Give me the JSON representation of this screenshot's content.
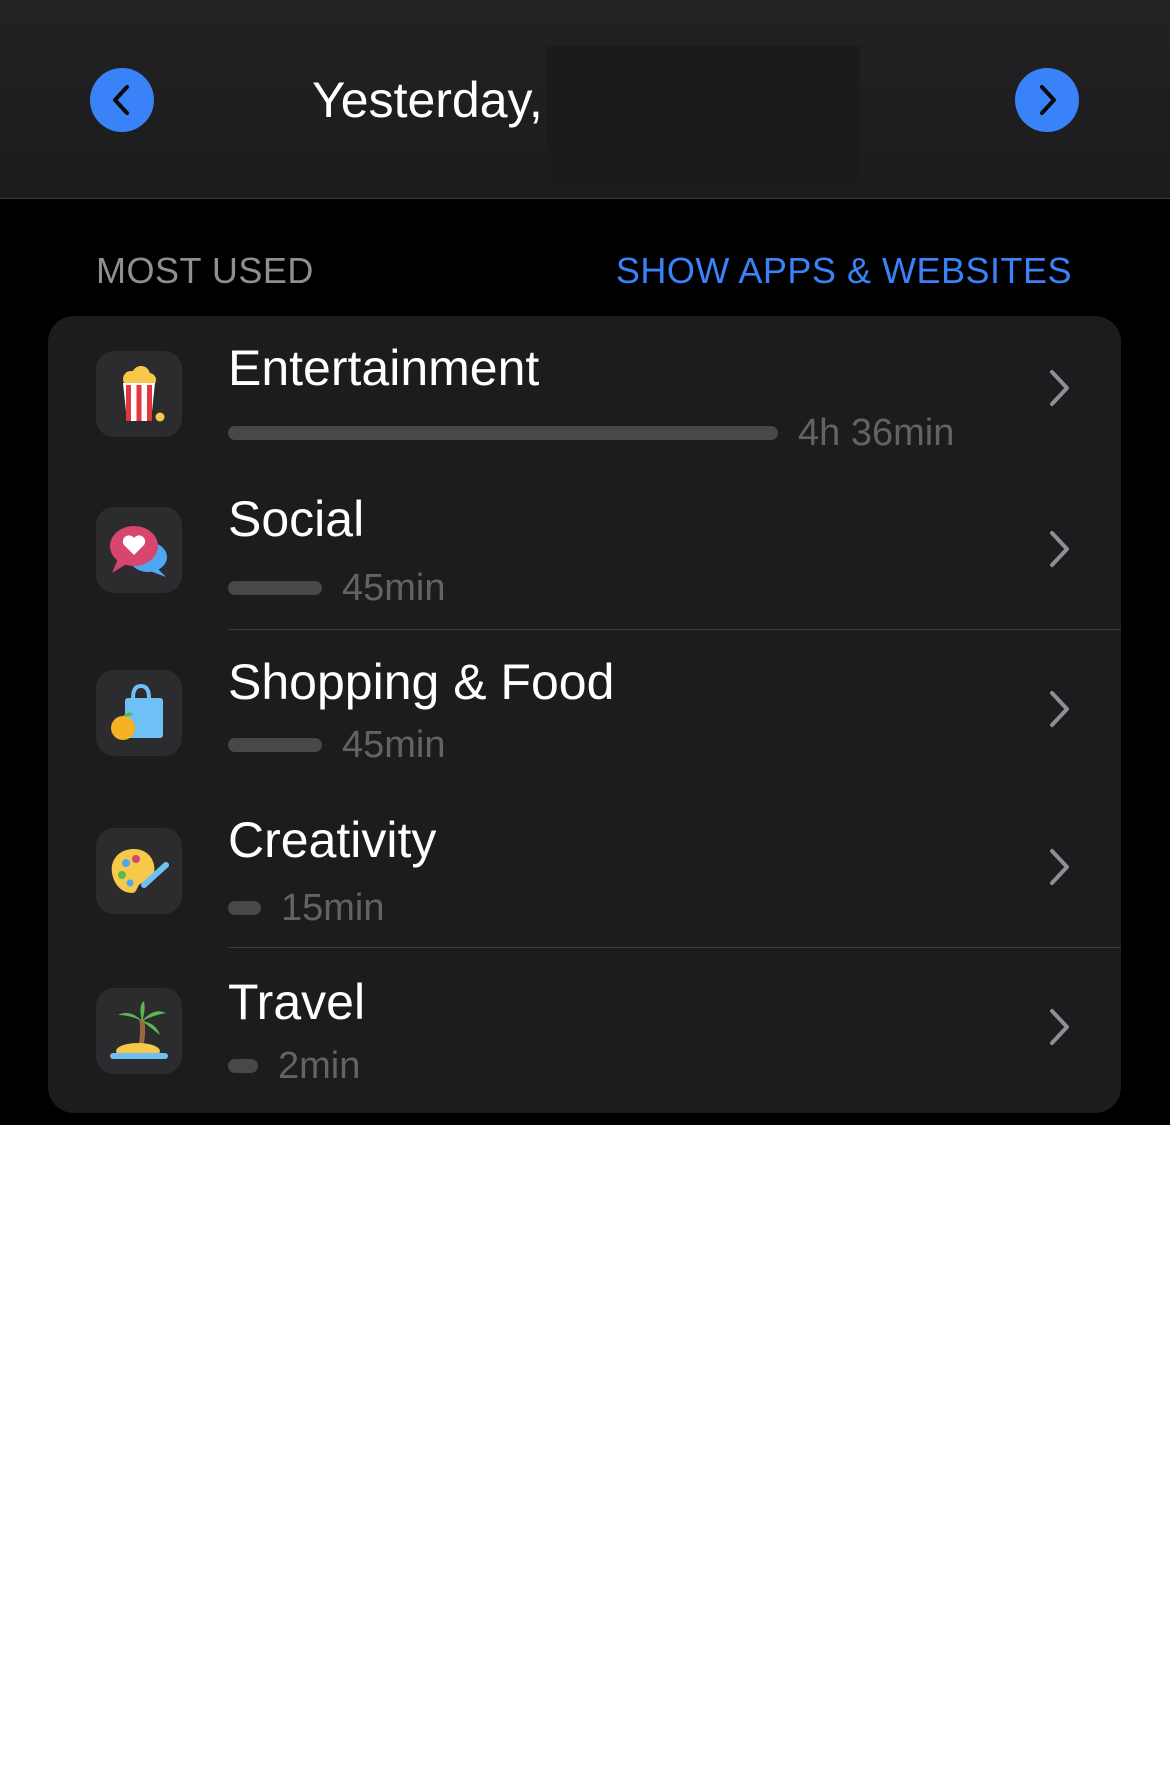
{
  "header": {
    "title": "Yesterday,",
    "prev_icon": "chevron-left-icon",
    "next_icon": "chevron-right-icon"
  },
  "section": {
    "label": "MOST USED",
    "action": "SHOW APPS & WEBSITES"
  },
  "colors": {
    "accent": "#3a82f7",
    "card_background": "#1c1c1e",
    "bar": "#48484a"
  },
  "categories": [
    {
      "name": "Entertainment",
      "time": "4h 36min",
      "usage_fraction": 1.0,
      "icon": "popcorn-icon"
    },
    {
      "name": "Social",
      "time": "45min",
      "usage_fraction": 0.17,
      "icon": "speech-bubbles-heart-icon"
    },
    {
      "name": "Shopping & Food",
      "time": "45min",
      "usage_fraction": 0.17,
      "icon": "shopping-bag-icon"
    },
    {
      "name": "Creativity",
      "time": "15min",
      "usage_fraction": 0.06,
      "icon": "palette-icon"
    },
    {
      "name": "Travel",
      "time": "2min",
      "usage_fraction": 0.05,
      "icon": "palm-island-icon"
    }
  ]
}
